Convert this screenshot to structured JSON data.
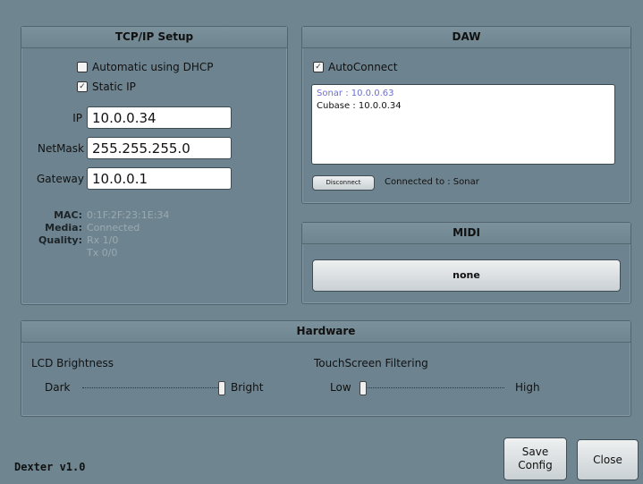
{
  "tcpip": {
    "title": "TCP/IP Setup",
    "dhcp_label": "Automatic using DHCP",
    "dhcp_checked": false,
    "static_label": "Static IP",
    "static_checked": true,
    "ip_label": "IP",
    "ip_value": "10.0.0.34",
    "netmask_label": "NetMask",
    "netmask_value": "255.255.255.0",
    "gateway_label": "Gateway",
    "gateway_value": "10.0.0.1",
    "mac_label": "MAC:",
    "mac_value": "0:1F:2F:23:1E:34",
    "media_label": "Media:",
    "media_value": "Connected",
    "quality_label": "Quality:",
    "quality_rx": "Rx 1/0",
    "quality_tx": "Tx 0/0"
  },
  "daw": {
    "title": "DAW",
    "autoconnect_label": "AutoConnect",
    "autoconnect_checked": true,
    "items": [
      {
        "label": "Sonar : 10.0.0.63",
        "selected": true
      },
      {
        "label": "Cubase : 10.0.0.34",
        "selected": false
      }
    ],
    "disconnect_label": "Disconnect",
    "status_text": "Connected to : Sonar"
  },
  "midi": {
    "title": "MIDI",
    "value": "none"
  },
  "hardware": {
    "title": "Hardware",
    "lcd_label": "LCD Brightness",
    "lcd_min": "Dark",
    "lcd_max": "Bright",
    "lcd_level": 1.0,
    "touch_label": "TouchScreen Filtering",
    "touch_min": "Low",
    "touch_max": "High",
    "touch_level": 0.0
  },
  "footer": {
    "version": "Dexter v1.0",
    "save_label_1": "Save",
    "save_label_2": "Config",
    "close_label": "Close"
  },
  "icons": {
    "checkbox_checked": "check-icon"
  }
}
